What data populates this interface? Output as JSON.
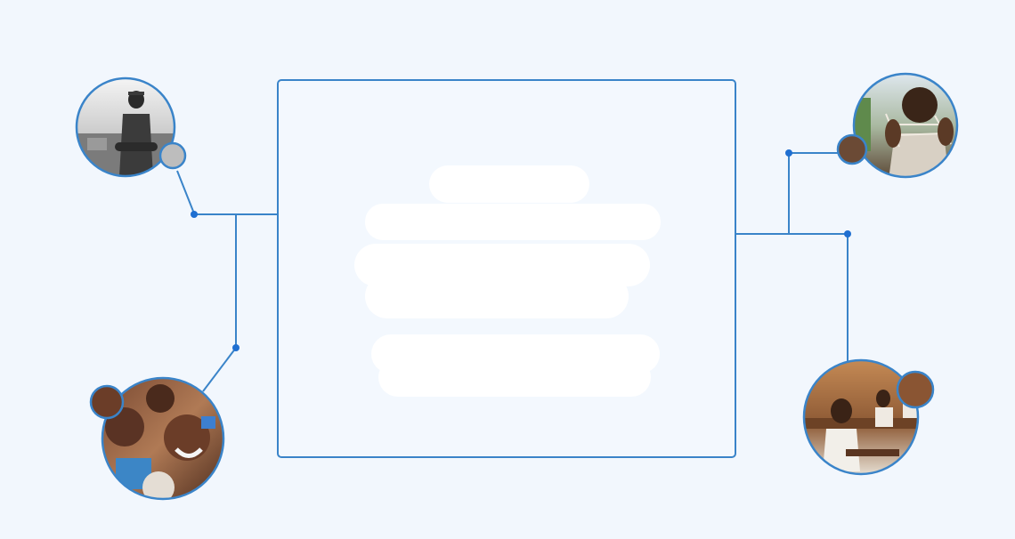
{
  "colors": {
    "background": "#f2f7fd",
    "line": "#3a84c9",
    "dot": "#1f6fd1",
    "frame_fill": "#f3f8fe",
    "redaction": "#ffffff"
  },
  "photos": [
    {
      "name": "photo-man-standing",
      "description_icon": "person-photo",
      "palette": "grayscale"
    },
    {
      "name": "photo-children-smiling",
      "description_icon": "group-photo",
      "palette": "warm"
    },
    {
      "name": "photo-boy-string-game",
      "description_icon": "person-photo",
      "palette": "warm"
    },
    {
      "name": "photo-classroom",
      "description_icon": "group-photo",
      "palette": "warm"
    }
  ],
  "central_panel": {
    "content_state": "redacted"
  }
}
